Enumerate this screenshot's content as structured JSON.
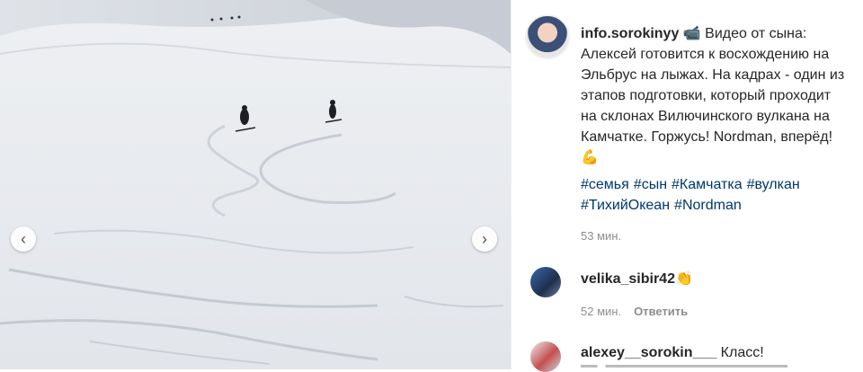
{
  "post": {
    "username": "info.sorokinyy",
    "caption": " 📹 Видео от сына: Алексей готовится к восхождению на Эльбрус на лыжах. На кадрах - один из этапов подготовки, который проходит на склонах Вилючинского вулкана на Камчатке. Горжусь! Nordman, вперёд! 💪",
    "hashtags": [
      "#семья",
      "#сын",
      "#Камчатка",
      "#вулкан",
      "#ТихийОкеан",
      "#Nordman"
    ],
    "time": "53 мин."
  },
  "comments": [
    {
      "username": "velika_sibir42",
      "text": " 👏",
      "time": "52 мин.",
      "reply_label": "Ответить"
    },
    {
      "username": "alexey__sorokin___",
      "text": " Класс!"
    }
  ],
  "carousel": {
    "prev_icon": "chevron-left-icon",
    "next_icon": "chevron-right-icon"
  },
  "colors": {
    "link": "#00376b",
    "meta": "#8e8e8e",
    "text": "#262626"
  }
}
